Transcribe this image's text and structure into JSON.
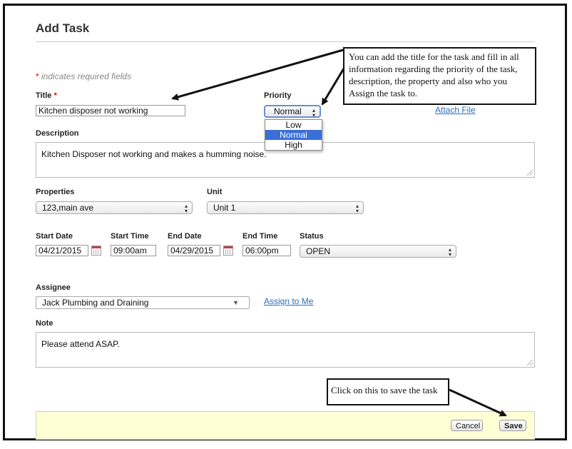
{
  "page": {
    "title": "Add Task",
    "required_note": "indicates required fields",
    "required_star": "*"
  },
  "form": {
    "title_label": "Title",
    "title_value": "Kitchen disposer not working",
    "priority_label": "Priority",
    "priority_value": "Normal",
    "priority_options": [
      "Low",
      "Normal",
      "High"
    ],
    "attach_file": "Attach File",
    "description_label": "Description",
    "description_value": "Kitchen Disposer  not working and makes a humming noise.",
    "properties_label": "Properties",
    "properties_value": "123,main ave",
    "unit_label": "Unit",
    "unit_value": "Unit 1",
    "start_date_label": "Start Date",
    "start_date_value": "04/21/2015",
    "start_time_label": "Start Time",
    "start_time_value": "09:00am",
    "end_date_label": "End Date",
    "end_date_value": "04/29/2015",
    "end_time_label": "End Time",
    "end_time_value": "06:00pm",
    "status_label": "Status",
    "status_value": "OPEN",
    "assignee_label": "Assignee",
    "assignee_value": "Jack Plumbing and Draining",
    "assign_to_me": "Assign to Me",
    "note_label": "Note",
    "note_value": "Please attend ASAP."
  },
  "footer": {
    "cancel_label": "Cancel",
    "save_label": "Save"
  },
  "annotations": {
    "top_callout": "You can add the title for the task and fill in all information regarding the priority of the task, description, the property and also who you Assign the task to.",
    "save_callout": "Click on this to save the task"
  }
}
